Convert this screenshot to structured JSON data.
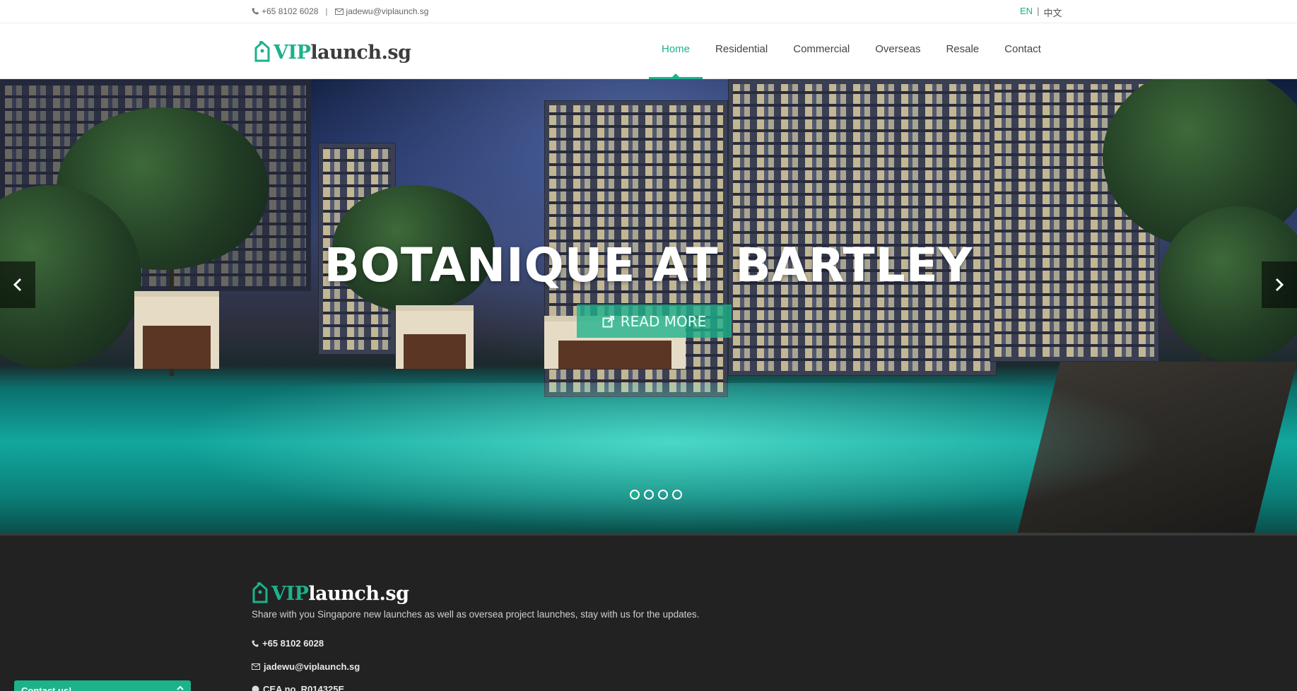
{
  "topbar": {
    "phone": "+65 8102 6028",
    "separator": "|",
    "email": "jadewu@viplaunch.sg",
    "lang_en": "EN",
    "lang_sep": "|",
    "lang_zh": "中文"
  },
  "brand": {
    "vip": "VIP",
    "rest": "launch.sg"
  },
  "nav": {
    "items": [
      {
        "label": "Home",
        "active": true
      },
      {
        "label": "Residential"
      },
      {
        "label": "Commercial"
      },
      {
        "label": "Overseas"
      },
      {
        "label": "Resale"
      },
      {
        "label": "Contact"
      }
    ]
  },
  "hero": {
    "title": "BOTANIQUE AT BARTLEY",
    "button_label": "READ MORE",
    "slide_count": 4,
    "active_slide": 1,
    "prev_icon": "chevron-left-icon",
    "next_icon": "chevron-right-icon"
  },
  "footer": {
    "tagline": "Share with you Singapore new launches as well as oversea project launches, stay with us for the updates.",
    "phone": "+65 8102 6028",
    "email": "jadewu@viplaunch.sg",
    "cea": "CEA no. R014325E"
  },
  "contact_tab": {
    "label": "Contact us!"
  },
  "colors": {
    "accent": "#1cb28b",
    "footer_bg": "#222222"
  }
}
